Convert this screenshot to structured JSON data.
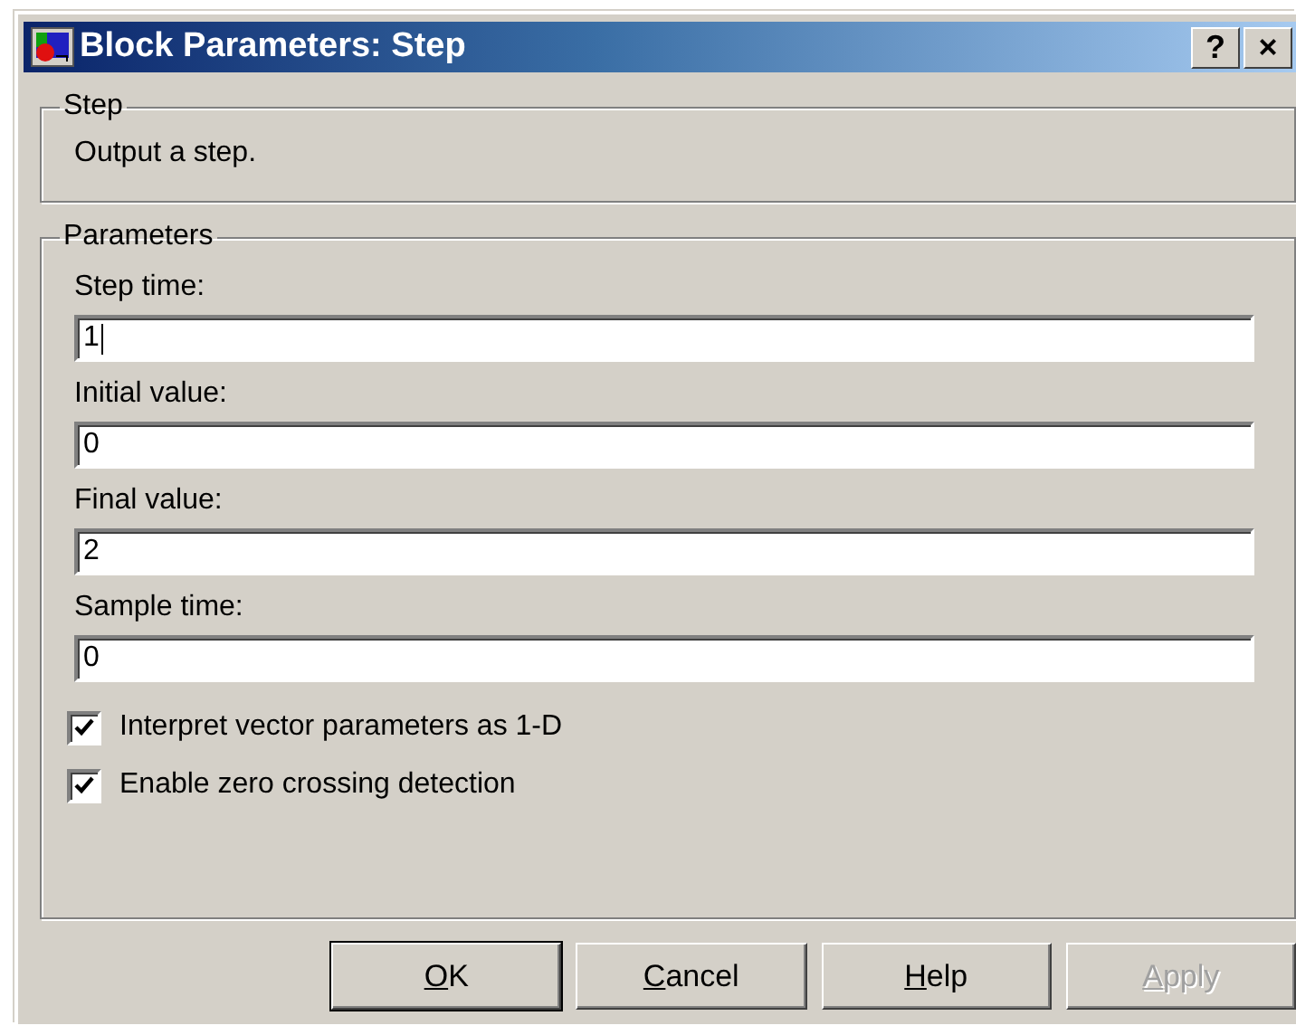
{
  "window": {
    "title": "Block Parameters: Step",
    "title_buttons": [
      "?",
      "×"
    ]
  },
  "description_group": {
    "title": "Step",
    "text": "Output a step."
  },
  "parameters_group": {
    "title": "Parameters",
    "fields": [
      {
        "label": "Step time:",
        "value": "1",
        "focused": true
      },
      {
        "label": "Initial value:",
        "value": "0",
        "focused": false
      },
      {
        "label": "Final value:",
        "value": "2",
        "focused": false
      },
      {
        "label": "Sample time:",
        "value": "0",
        "focused": false
      }
    ],
    "checkboxes": [
      {
        "label": "Interpret vector parameters as 1-D",
        "checked": true
      },
      {
        "label": "Enable zero crossing detection",
        "checked": true
      }
    ]
  },
  "buttons": [
    {
      "label": "OK",
      "default": true,
      "disabled": false
    },
    {
      "label": "Cancel",
      "default": false,
      "disabled": false
    },
    {
      "label": "Help",
      "default": false,
      "disabled": false
    },
    {
      "label": "Apply",
      "default": false,
      "disabled": true
    }
  ]
}
